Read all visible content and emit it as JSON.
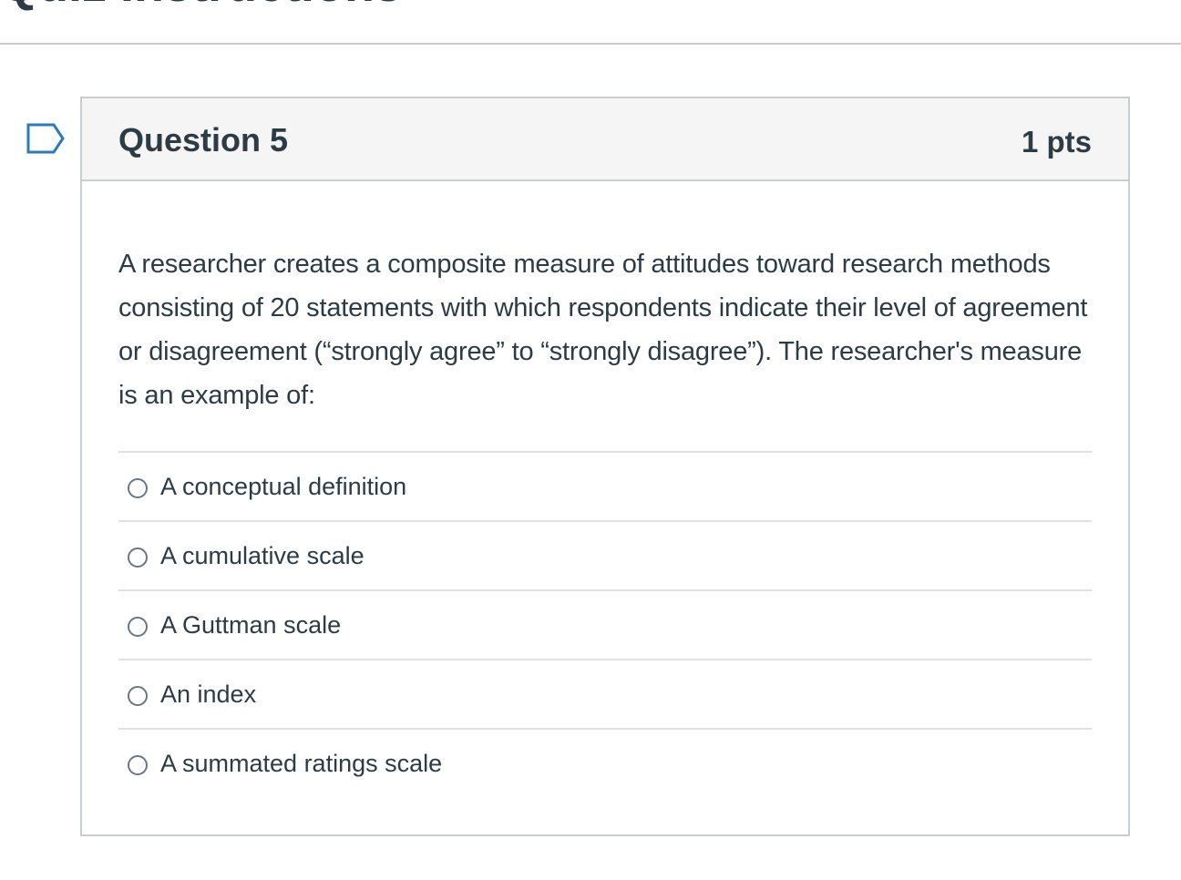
{
  "page": {
    "title": "Quiz Instructions"
  },
  "question": {
    "name": "Question 5",
    "points": "1 pts",
    "text": "A researcher creates a composite measure of attitudes toward research methods consisting of 20 statements with which respondents indicate their level of agreement or disagreement (“strongly agree” to “strongly disagree”). The researcher's measure is an example of:",
    "answers": [
      {
        "label": "A conceptual definition",
        "selected": false
      },
      {
        "label": "A cumulative scale",
        "selected": false
      },
      {
        "label": "A Guttman scale",
        "selected": false
      },
      {
        "label": "An index",
        "selected": false
      },
      {
        "label": "A summated ratings scale",
        "selected": false
      }
    ]
  },
  "icons": {
    "flag": "flag-question-icon"
  },
  "colors": {
    "text": "#2d3b45",
    "header_bg": "#f5f5f5",
    "border": "#c7cdd1",
    "flag_stroke": "#2b7abc"
  }
}
